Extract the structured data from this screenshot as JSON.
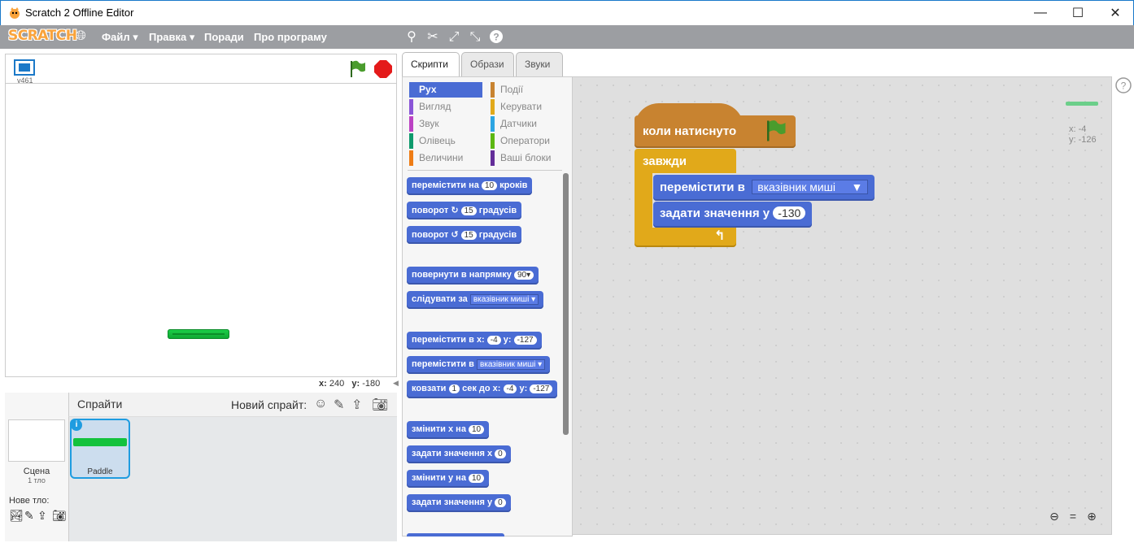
{
  "window": {
    "title": "Scratch 2 Offline Editor"
  },
  "menu": {
    "logo": "SCRATCH",
    "items": [
      "Файл",
      "Правка",
      "Поради",
      "Про програму"
    ]
  },
  "stage": {
    "version": "v461",
    "coords": {
      "x_label": "x:",
      "x": "240",
      "y_label": "y:",
      "y": "-180"
    }
  },
  "sprites": {
    "header": "Спрайти",
    "new_sprite": "Новий спрайт:",
    "scene_label": "Сцена",
    "scene_sub": "1 тло",
    "new_backdrop": "Нове тло:",
    "items": [
      {
        "name": "Paddle"
      }
    ]
  },
  "tabs": [
    "Скрипти",
    "Образи",
    "Звуки"
  ],
  "categories": [
    {
      "label": "Рух",
      "color": "#4a6cd4"
    },
    {
      "label": "Події",
      "color": "#c88330"
    },
    {
      "label": "Вигляд",
      "color": "#8a55d7"
    },
    {
      "label": "Керувати",
      "color": "#e1a91a"
    },
    {
      "label": "Звук",
      "color": "#bb42c3"
    },
    {
      "label": "Датчики",
      "color": "#2ca5e2"
    },
    {
      "label": "Олівець",
      "color": "#0e9a6c"
    },
    {
      "label": "Оператори",
      "color": "#5cb712"
    },
    {
      "label": "Величини",
      "color": "#ee7d16"
    },
    {
      "label": "Ваші блоки",
      "color": "#632d99"
    }
  ],
  "palette_blocks": {
    "move": {
      "a": "перемістити на",
      "v": "10",
      "b": "кроків"
    },
    "turn_right": {
      "a": "поворот",
      "v": "15",
      "b": "градусів"
    },
    "turn_left": {
      "a": "поворот",
      "v": "15",
      "b": "градусів"
    },
    "point_dir": {
      "a": "повернути в напрямку",
      "v": "90▾"
    },
    "follow": {
      "a": "слідувати за",
      "dd": "вказівник миші"
    },
    "goto_xy": {
      "a": "перемістити в x:",
      "x": "-4",
      "ylab": "y:",
      "y": "-127"
    },
    "goto": {
      "a": "перемістити в",
      "dd": "вказівник миші"
    },
    "glide": {
      "a": "ковзати",
      "v": "1",
      "b": "сек до x:",
      "x": "-4",
      "ylab": "y:",
      "y": "-127"
    },
    "change_x": {
      "a": "змінити х на",
      "v": "10"
    },
    "set_x": {
      "a": "задати значення х",
      "v": "0"
    },
    "change_y": {
      "a": "змінити у на",
      "v": "10"
    },
    "set_y": {
      "a": "задати значення у",
      "v": "0"
    }
  },
  "script": {
    "hat": "коли натиснуто",
    "forever": "завжди",
    "goto_a": "перемістити в",
    "goto_dd": "вказівник миші",
    "sety_a": "задати значення у",
    "sety_v": "-130",
    "readout_x": "x: -4",
    "readout_y": "y: -126"
  }
}
